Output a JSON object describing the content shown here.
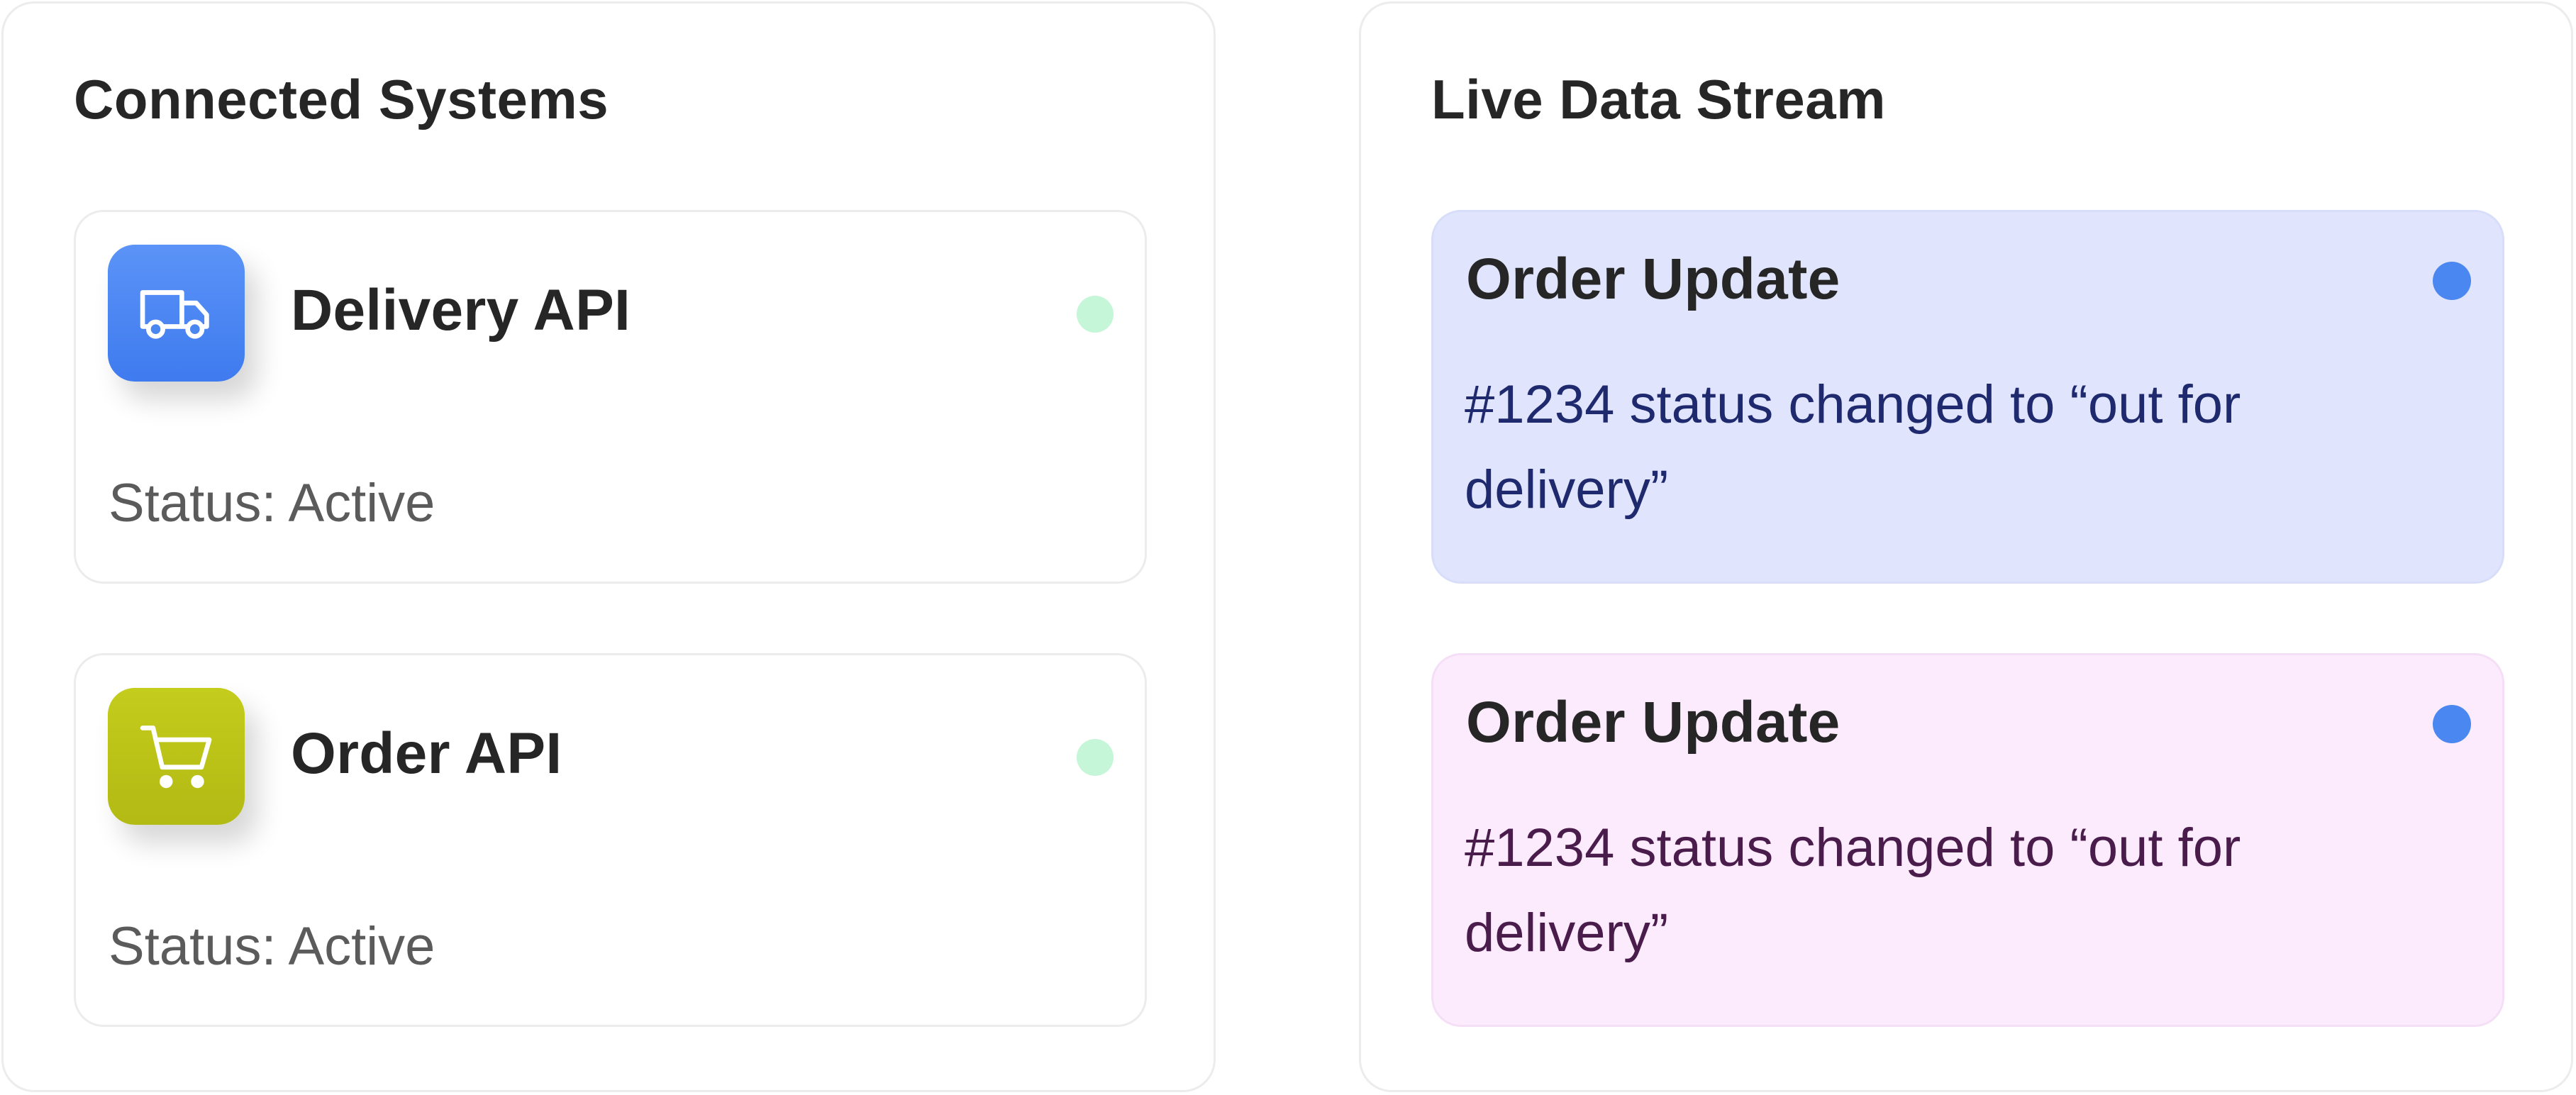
{
  "connected_systems": {
    "title": "Connected Systems",
    "items": [
      {
        "name": "Delivery API",
        "icon": "truck-icon",
        "icon_color": "#4a87f1",
        "status": "Status: Active",
        "indicator_color": "#c5f6d8"
      },
      {
        "name": "Order API",
        "icon": "shopping-cart-icon",
        "icon_color": "#bcc418",
        "status": "Status: Active",
        "indicator_color": "#c5f6d8"
      }
    ]
  },
  "live_data_stream": {
    "title": "Live Data Stream",
    "events": [
      {
        "title": "Order Update",
        "message": "#1234 status changed to “out for delivery”",
        "background": "#e0e5fd",
        "indicator_color": "#4a87f1"
      },
      {
        "title": "Order Update",
        "message": "#1234 status changed to “out for delivery”",
        "background": "#fcebfd",
        "indicator_color": "#4a87f1"
      }
    ]
  }
}
